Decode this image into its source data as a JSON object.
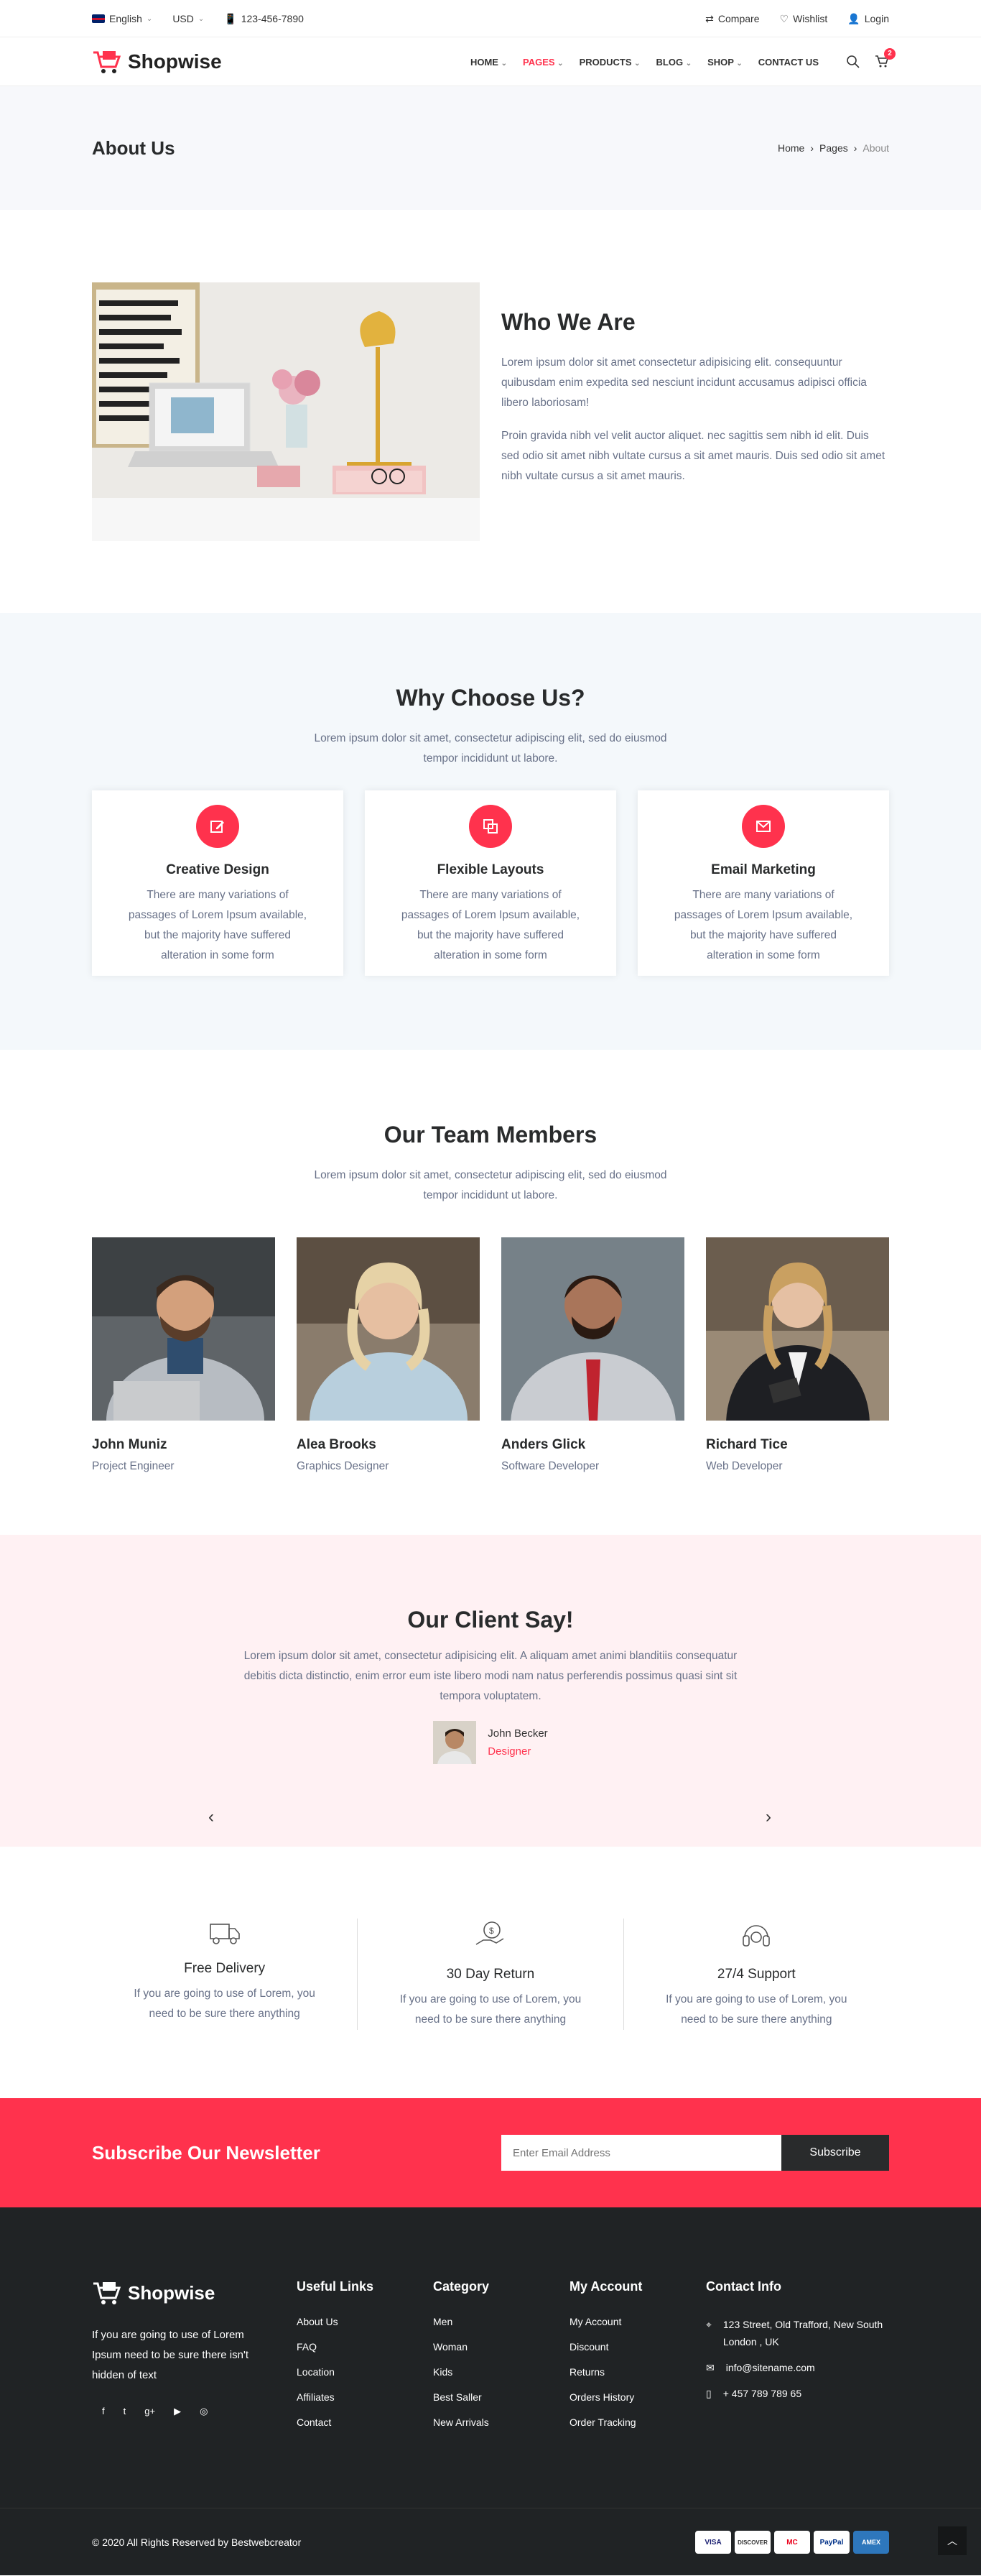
{
  "topbar": {
    "language": "English",
    "currency": "USD",
    "phone": "123-456-7890",
    "compare": "Compare",
    "wishlist": "Wishlist",
    "login": "Login"
  },
  "header": {
    "brand": "Shopwise",
    "nav": [
      "HOME",
      "PAGES",
      "PRODUCTS",
      "BLOG",
      "SHOP",
      "CONTACT US"
    ],
    "cart_count": "2"
  },
  "pagehead": {
    "title": "About Us",
    "crumbs": [
      "Home",
      "Pages",
      "About"
    ]
  },
  "about": {
    "title": "Who We Are",
    "p1": "Lorem ipsum dolor sit amet consectetur adipisicing elit. consequuntur quibusdam enim expedita sed nesciunt incidunt accusamus adipisci officia libero laboriosam!",
    "p2": "Proin gravida nibh vel velit auctor aliquet. nec sagittis sem nibh id elit. Duis sed odio sit amet nibh vultate cursus a sit amet mauris. Duis sed odio sit amet nibh vultate cursus a sit amet mauris."
  },
  "why": {
    "title": "Why Choose Us?",
    "subtitle": "Lorem ipsum dolor sit amet, consectetur adipiscing elit, sed do eiusmod tempor incididunt ut labore.",
    "cards": [
      {
        "title": "Creative Design",
        "text": "There are many variations of passages of Lorem Ipsum available, but the majority have suffered alteration in some form",
        "icon": "edit-icon"
      },
      {
        "title": "Flexible Layouts",
        "text": "There are many variations of passages of Lorem Ipsum available, but the majority have suffered alteration in some form",
        "icon": "layers-icon"
      },
      {
        "title": "Email Marketing",
        "text": "There are many variations of passages of Lorem Ipsum available, but the majority have suffered alteration in some form",
        "icon": "mail-icon"
      }
    ]
  },
  "team": {
    "title": "Our Team Members",
    "subtitle": "Lorem ipsum dolor sit amet, consectetur adipiscing elit, sed do eiusmod tempor incididunt ut labore.",
    "members": [
      {
        "name": "John Muniz",
        "role": "Project Engineer"
      },
      {
        "name": "Alea Brooks",
        "role": "Graphics Designer"
      },
      {
        "name": "Anders Glick",
        "role": "Software Developer"
      },
      {
        "name": "Richard Tice",
        "role": "Web Developer"
      }
    ]
  },
  "client": {
    "title": "Our Client Say!",
    "quote": "Lorem ipsum dolor sit amet, consectetur adipisicing elit. A aliquam amet animi blanditiis consequatur debitis dicta distinctio, enim error eum iste libero modi nam natus perferendis possimus quasi sint sit tempora voluptatem.",
    "name": "John Becker",
    "role": "Designer"
  },
  "features": [
    {
      "title": "Free Delivery",
      "text": "If you are going to use of Lorem, you need to be sure there anything",
      "icon": "truck-icon"
    },
    {
      "title": "30 Day Return",
      "text": "If you are going to use of Lorem, you need to be sure there anything",
      "icon": "money-return-icon"
    },
    {
      "title": "27/4 Support",
      "text": "If you are going to use of Lorem, you need to be sure there anything",
      "icon": "headset-icon"
    }
  ],
  "newsletter": {
    "title": "Subscribe Our Newsletter",
    "placeholder": "Enter Email Address",
    "button": "Subscribe"
  },
  "footer": {
    "brand": "Shopwise",
    "desc": "If you are going to use of Lorem Ipsum need to be sure there isn't hidden of text",
    "cols": [
      {
        "title": "Useful Links",
        "items": [
          "About Us",
          "FAQ",
          "Location",
          "Affiliates",
          "Contact"
        ]
      },
      {
        "title": "Category",
        "items": [
          "Men",
          "Woman",
          "Kids",
          "Best Saller",
          "New Arrivals"
        ]
      },
      {
        "title": "My Account",
        "items": [
          "My Account",
          "Discount",
          "Returns",
          "Orders History",
          "Order Tracking"
        ]
      }
    ],
    "contact_title": "Contact Info",
    "address": "123 Street, Old Trafford, New South London , UK",
    "email": "info@sitename.com",
    "phone": "+ 457 789 789 65",
    "copyright": "© 2020 All Rights Reserved by Bestwebcreator",
    "payments": [
      "VISA",
      "DISCOVER",
      "MC",
      "PayPal",
      "AMEX"
    ]
  },
  "colors": {
    "accent": "#ff324d",
    "dark": "#202325",
    "text_muted": "#687188"
  }
}
